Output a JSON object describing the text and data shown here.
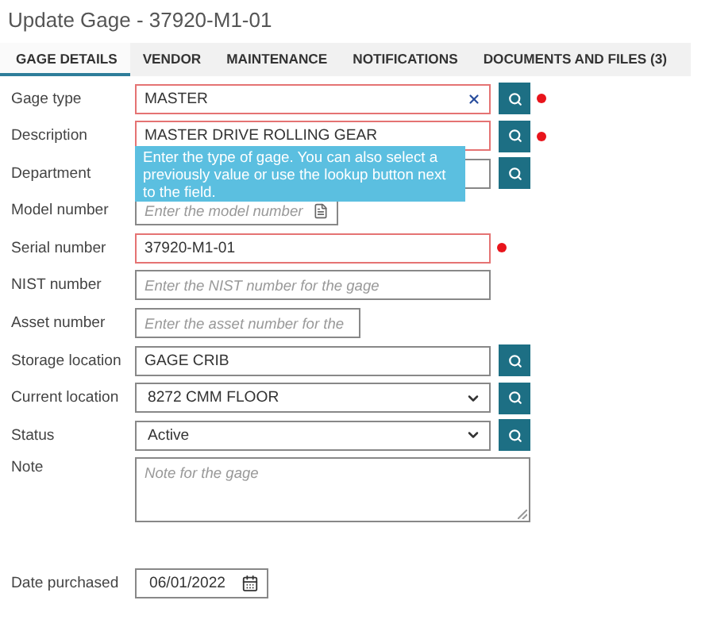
{
  "title": "Update Gage - 37920-M1-01",
  "tabs": [
    {
      "label": "GAGE DETAILS",
      "selected": true
    },
    {
      "label": "VENDOR",
      "selected": false
    },
    {
      "label": "MAINTENANCE",
      "selected": false
    },
    {
      "label": "NOTIFICATIONS",
      "selected": false
    },
    {
      "label": "DOCUMENTS AND FILES (3)",
      "selected": false
    }
  ],
  "fields": [
    {
      "label": "Gage type",
      "kind": "text",
      "value": "MASTER",
      "required": true,
      "lookup": true,
      "clearable": true
    },
    {
      "label": "Description",
      "kind": "text",
      "value": "MASTER DRIVE ROLLING GEAR",
      "required": true,
      "lookup": true
    },
    {
      "label": "Department",
      "kind": "text",
      "lookup": true
    },
    {
      "label": "Model number",
      "kind": "short_text",
      "placeholder": "Enter the model number"
    },
    {
      "label": "Serial number",
      "kind": "text",
      "value": "37920-M1-01",
      "required": true
    },
    {
      "label": "NIST number",
      "kind": "text",
      "placeholder": "Enter the NIST number for the gage"
    },
    {
      "label": "Asset number",
      "kind": "short_text",
      "placeholder": "Enter the asset number for the"
    },
    {
      "label": "Storage location",
      "kind": "text",
      "value": "GAGE CRIB",
      "lookup": true
    },
    {
      "label": "Current location",
      "kind": "select",
      "value": "8272 CMM FLOOR",
      "lookup": true
    },
    {
      "label": "Status",
      "kind": "select",
      "value": "Active",
      "lookup": true
    },
    {
      "label": "Note",
      "kind": "textarea",
      "placeholder": "Note for the gage"
    },
    {
      "label": "Date purchased",
      "kind": "date",
      "value": "06/01/2022"
    }
  ],
  "tooltip": "Enter the type of gage. You can also select a previously value or use the lookup button next to the field."
}
